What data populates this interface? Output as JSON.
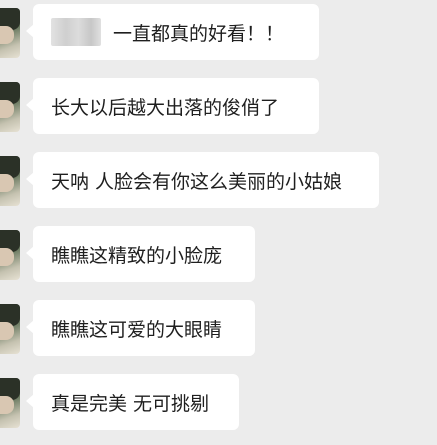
{
  "messages": [
    {
      "text": "一直都真的好看！！",
      "redacted_prefix": true
    },
    {
      "text": "长大以后越大出落的俊俏了"
    },
    {
      "text": "天呐 人脸会有你这么美丽的小姑娘"
    },
    {
      "text": "瞧瞧这精致的小脸庞"
    },
    {
      "text": "瞧瞧这可爱的大眼睛"
    },
    {
      "text": "真是完美 无可挑剔"
    }
  ]
}
